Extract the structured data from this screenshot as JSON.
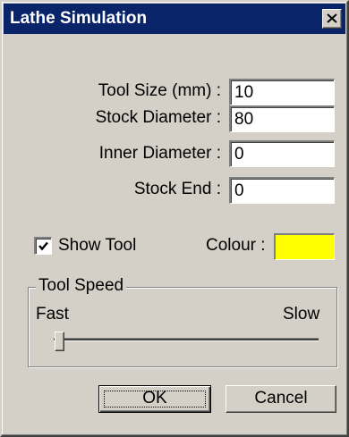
{
  "window": {
    "title": "Lathe Simulation"
  },
  "fields": [
    {
      "label": "Tool Size (mm) :",
      "value": "10"
    },
    {
      "label": "Stock Diameter :",
      "value": "80"
    },
    {
      "label": "Inner Diameter :",
      "value": "0"
    },
    {
      "label": "Stock End :",
      "value": "0"
    }
  ],
  "show_tool": {
    "label": "Show Tool",
    "checked": true
  },
  "colour": {
    "label": "Colour :",
    "value": "#ffff00"
  },
  "tool_speed": {
    "title": "Tool Speed",
    "min_label": "Fast",
    "max_label": "Slow",
    "position": 0
  },
  "buttons": {
    "ok": "OK",
    "cancel": "Cancel"
  },
  "icons": {
    "close": "close-icon",
    "check": "checkmark-icon"
  }
}
